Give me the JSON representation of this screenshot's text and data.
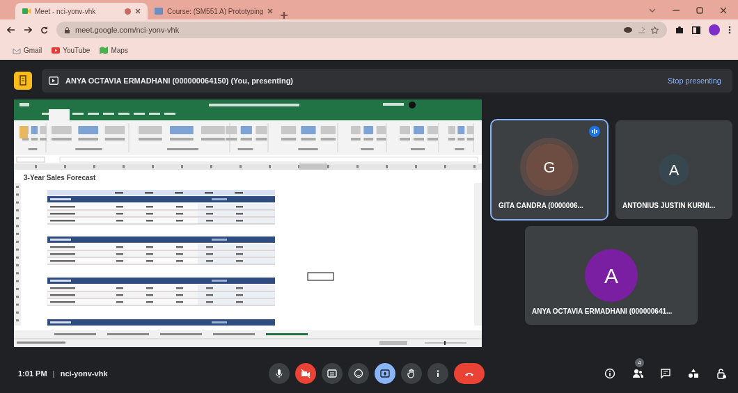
{
  "browser": {
    "tabs": [
      {
        "title": "Meet - nci-yonv-vhk",
        "selected": true
      },
      {
        "title": "Course: (SM551 A) Prototyping",
        "selected": false
      }
    ],
    "url": "meet.google.com/nci-yonv-vhk",
    "bookmarks": [
      {
        "label": "Gmail"
      },
      {
        "label": "YouTube"
      },
      {
        "label": "Maps"
      }
    ]
  },
  "presenting_bar": {
    "text": "ANYA OCTAVIA ERMADHANI (000000064150) (You, presenting)",
    "button": "Stop presenting"
  },
  "shared_screen": {
    "sheet_title": "3-Year Sales Forecast"
  },
  "participants": [
    {
      "initial": "G",
      "name": "GITA CANDRA (0000006...",
      "color": "#6d4c41",
      "speaking": true
    },
    {
      "initial": "A",
      "name": "ANTONIUS JUSTIN KURNI...",
      "color": "#37474f",
      "speaking": false
    },
    {
      "initial": "A",
      "name": "ANYA OCTAVIA ERMADHANI (000000641...",
      "color": "#7b1fa2",
      "speaking": false
    }
  ],
  "bottom_bar": {
    "time": "1:01 PM",
    "separator": "|",
    "meeting_code": "nci-yonv-vhk",
    "controls": [
      {
        "kind": "mic",
        "off": false,
        "selected": false
      },
      {
        "kind": "camera",
        "off": true,
        "selected": false
      },
      {
        "kind": "captions",
        "off": false,
        "selected": false
      },
      {
        "kind": "emoji",
        "off": false,
        "selected": false
      },
      {
        "kind": "present",
        "off": false,
        "selected": true
      },
      {
        "kind": "hand",
        "off": false,
        "selected": false
      },
      {
        "kind": "more",
        "off": false,
        "selected": false
      },
      {
        "kind": "end",
        "off": false,
        "selected": false
      }
    ],
    "people_count": "4"
  }
}
